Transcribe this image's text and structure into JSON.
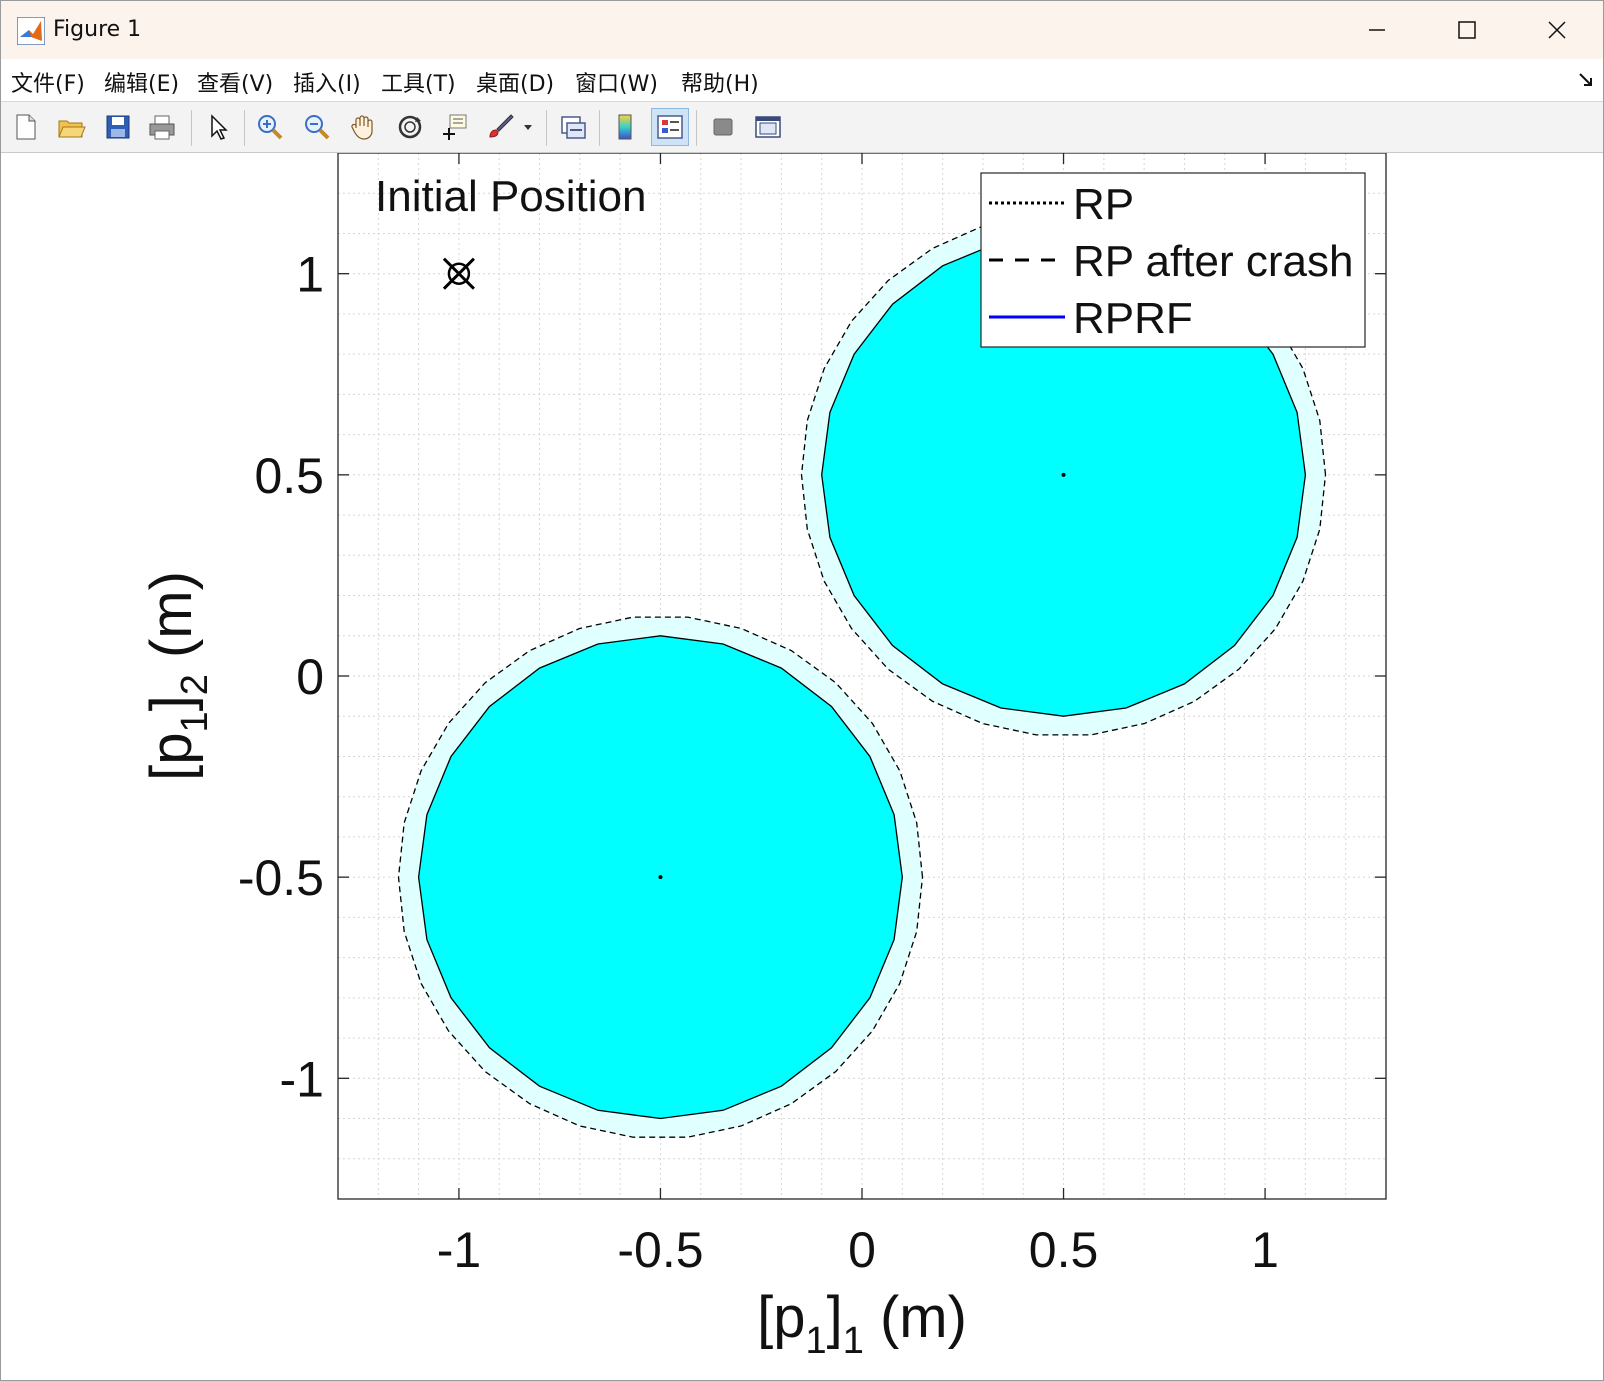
{
  "window": {
    "title": "Figure 1",
    "controls": {
      "minimize": "—",
      "maximize": "☐",
      "close": "✕"
    }
  },
  "menu": [
    {
      "label": "文件(F)"
    },
    {
      "label": "编辑(E)"
    },
    {
      "label": "查看(V)"
    },
    {
      "label": "插入(I)"
    },
    {
      "label": "工具(T)"
    },
    {
      "label": "桌面(D)"
    },
    {
      "label": "窗口(W)"
    },
    {
      "label": "帮助(H)"
    }
  ],
  "toolbar": {
    "tools": [
      {
        "icon": "new-figure-icon"
      },
      {
        "icon": "open-file-icon"
      },
      {
        "icon": "save-icon"
      },
      {
        "icon": "print-icon"
      },
      {
        "icon": "pointer-icon"
      },
      {
        "icon": "zoom-in-icon"
      },
      {
        "icon": "zoom-out-icon"
      },
      {
        "icon": "pan-icon"
      },
      {
        "icon": "rotate-3d-icon"
      },
      {
        "icon": "data-cursor-icon"
      },
      {
        "icon": "brush-icon"
      },
      {
        "icon": "link-plot-icon"
      },
      {
        "icon": "colorbar-icon"
      },
      {
        "icon": "legend-icon"
      },
      {
        "icon": "hide-plot-tools-icon"
      },
      {
        "icon": "show-plot-tools-icon"
      }
    ]
  },
  "chart_data": {
    "type": "scatter",
    "title": "",
    "annotation": "Initial Position",
    "xlabel_base": "[p",
    "xlabel_sub1": "1",
    "xlabel_mid": "]",
    "xlabel_sub2": "1",
    "xlabel_unit": " (m)",
    "ylabel_base": "[p",
    "ylabel_sub1": "1",
    "ylabel_mid": "]",
    "ylabel_sub2": "2",
    "ylabel_unit": " (m)",
    "xlim": [
      -1.3,
      1.3
    ],
    "ylim": [
      -1.3,
      1.3
    ],
    "xticks": [
      -1,
      -0.5,
      0,
      0.5,
      1
    ],
    "yticks": [
      -1,
      -0.5,
      0,
      0.5,
      1
    ],
    "xtick_labels": [
      "-1",
      "-0.5",
      "0",
      "0.5",
      "1"
    ],
    "ytick_labels": [
      "-1",
      "-0.5",
      "0",
      "0.5",
      "1"
    ],
    "grid": "minor dotted",
    "legend_position": "top-right",
    "legend": [
      {
        "label": "RP",
        "style": "dotted",
        "color": "#000000"
      },
      {
        "label": "RP after crash",
        "style": "dashed",
        "color": "#000000"
      },
      {
        "label": "RPRF",
        "style": "solid",
        "color": "#0000ff"
      }
    ],
    "initial_position": {
      "x": -1,
      "y": 1,
      "marker": "x-circle"
    },
    "obstacles": [
      {
        "center_x": -0.5,
        "center_y": -0.5,
        "radius": 0.6,
        "outer_radius": 0.65,
        "fill": "#00ffff",
        "halo": "#e0ffff"
      },
      {
        "center_x": 0.5,
        "center_y": 0.5,
        "radius": 0.6,
        "outer_radius": 0.65,
        "fill": "#00ffff",
        "halo": "#e0ffff"
      }
    ]
  }
}
